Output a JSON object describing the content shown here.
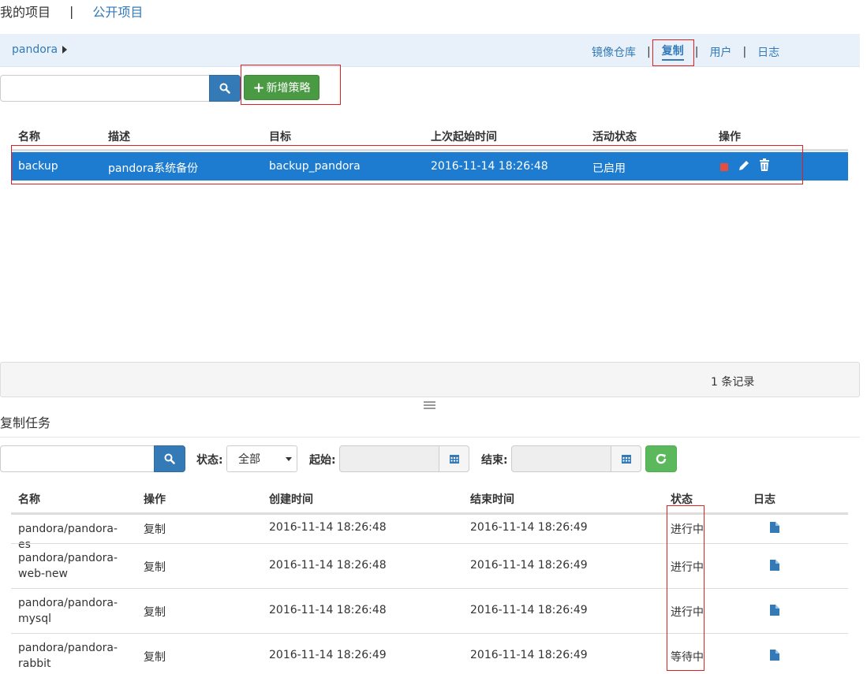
{
  "top_tabs": {
    "my_projects": "我的项目",
    "separator": "|",
    "public_projects": "公开项目"
  },
  "breadcrumb": {
    "project": "pandora"
  },
  "subnav": {
    "items": [
      "镜像仓库",
      "复制",
      "用户",
      "日志"
    ],
    "separator": "|",
    "active": "复制"
  },
  "policy_toolbar": {
    "search_placeholder": "",
    "add_label": "新增策略"
  },
  "policy_table": {
    "headers": [
      "名称",
      "描述",
      "目标",
      "上次起始时间",
      "活动状态",
      "操作"
    ],
    "rows": [
      {
        "name": "backup",
        "description": "pandora系统备份",
        "target": "backup_pandora",
        "last_start": "2016-11-14 18:26:48",
        "status": "已启用"
      }
    ]
  },
  "policy_footer": {
    "records": "1 条记录"
  },
  "jobs_section": {
    "title": "复制任务",
    "status_label": "状态:",
    "status_value": "全部",
    "start_label": "起始:",
    "end_label": "结束:"
  },
  "job_table": {
    "headers": [
      "名称",
      "操作",
      "创建时间",
      "结束时间",
      "状态",
      "日志"
    ],
    "rows": [
      {
        "name": "pandora/pandora-es",
        "op": "复制",
        "created": "2016-11-14 18:26:48",
        "ended": "2016-11-14 18:26:49",
        "status": "进行中"
      },
      {
        "name": "pandora/pandora-web-new",
        "op": "复制",
        "created": "2016-11-14 18:26:48",
        "ended": "2016-11-14 18:26:49",
        "status": "进行中"
      },
      {
        "name": "pandora/pandora-mysql",
        "op": "复制",
        "created": "2016-11-14 18:26:48",
        "ended": "2016-11-14 18:26:49",
        "status": "进行中"
      },
      {
        "name": "pandora/pandora-rabbit",
        "op": "复制",
        "created": "2016-11-14 18:26:49",
        "ended": "2016-11-14 18:26:49",
        "status": "等待中"
      }
    ]
  },
  "colors": {
    "accent": "#337ab7",
    "selected_row": "#1e7cd0",
    "add_button": "#4a9a43",
    "refresh_button": "#5cb85c",
    "highlight_box": "#e02020"
  },
  "icons": [
    "caret-right-icon",
    "search-icon",
    "plus-icon",
    "stop-icon",
    "edit-icon",
    "trash-icon",
    "grip-icon",
    "calendar-icon",
    "refresh-icon",
    "file-icon"
  ]
}
